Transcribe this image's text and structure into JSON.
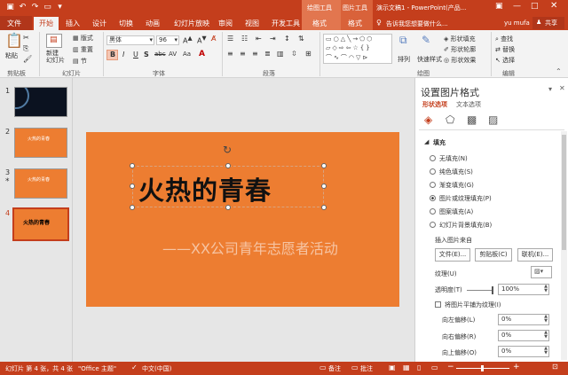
{
  "title_bar": {
    "context_tools_1": "绘图工具",
    "context_tools_2": "图片工具",
    "document_title": "演示文稿1 - PowerPoint(产品..."
  },
  "tabs": [
    "文件",
    "开始",
    "插入",
    "设计",
    "切换",
    "动画",
    "幻灯片放映",
    "审阅",
    "视图",
    "开发工具",
    "格式",
    "格式"
  ],
  "tell_me": "告诉我您想要做什么...",
  "user": "yu mufa",
  "share": "共享",
  "ribbon": {
    "paste": "粘贴",
    "new_slide": "新建\n幻灯片",
    "layout": "版式",
    "reset": "重置",
    "section": "节",
    "font_name": "黑体",
    "font_size": "96",
    "fill": "形状填充",
    "outline": "形状轮廓",
    "effects": "形状效果",
    "arrange": "排列",
    "quick_styles": "快速样式",
    "find": "查找",
    "replace": "替换",
    "select": "选择",
    "groups": {
      "clipboard": "剪贴板",
      "slides": "幻灯片",
      "font": "字体",
      "paragraph": "段落",
      "drawing": "绘图",
      "editing": "编辑"
    },
    "format_btns": [
      "B",
      "I",
      "U",
      "S",
      "abc",
      "AV",
      "Aa",
      "A"
    ]
  },
  "slides": [
    {
      "num": "1",
      "title": "",
      "style": "dark"
    },
    {
      "num": "2",
      "title": "火热的青春",
      "style": "orange"
    },
    {
      "num": "3",
      "title": "火热的青春",
      "style": "orange",
      "star": "*"
    },
    {
      "num": "4",
      "title": "火热的青春",
      "style": "orange-selected"
    }
  ],
  "slide": {
    "title": "火热的青春",
    "subtitle": "——XX公司青年志愿者活动",
    "bg_color": "#ed7d31"
  },
  "pane": {
    "title": "设置图片格式",
    "tab_shape": "形状选项",
    "tab_text": "文本选项",
    "section_fill": "填充",
    "fill_options": [
      {
        "label": "无填充(N)",
        "checked": false
      },
      {
        "label": "纯色填充(S)",
        "checked": false
      },
      {
        "label": "渐变填充(G)",
        "checked": false
      },
      {
        "label": "图片或纹理填充(P)",
        "checked": true
      },
      {
        "label": "图案填充(A)",
        "checked": false
      },
      {
        "label": "幻灯片背景填充(B)",
        "checked": false
      }
    ],
    "insert_from": "插入图片来自",
    "btn_file": "文件(E)...",
    "btn_clipboard": "剪贴板(C)",
    "btn_online": "联机(E)...",
    "texture": "纹理(U)",
    "transparency_label": "透明度(T)",
    "transparency_value": "100%",
    "transparency_level": 1.0,
    "tile": "将图片平铺为纹理(I)",
    "offset_left_label": "向左偏移(L)",
    "offset_left": "0%",
    "offset_right_label": "向右偏移(R)",
    "offset_right": "0%",
    "offset_top_label": "向上偏移(O)",
    "offset_top": "0%"
  },
  "status": {
    "slide_info": "幻灯片 第 4 张，共 4 张",
    "theme": "\"Office 主题\"",
    "language": "中文(中国)",
    "notes": "备注",
    "comments": "批注"
  },
  "colors": {
    "accent": "#c43e1c",
    "slide_orange": "#ed7d31"
  }
}
